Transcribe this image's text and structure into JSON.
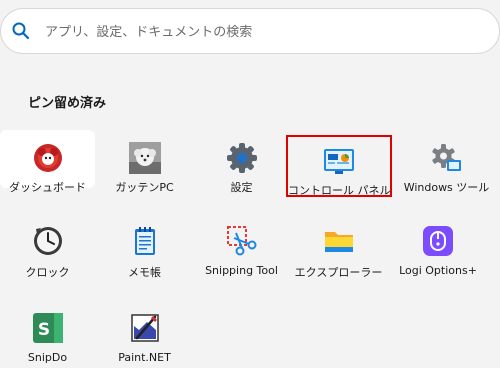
{
  "search": {
    "placeholder": "アプリ、設定、ドキュメントの検索"
  },
  "pinned": {
    "title": "ピン留め済み",
    "items": [
      {
        "label": "ダッシュボード",
        "icon": "dashboard-app-icon"
      },
      {
        "label": "ガッテンPC",
        "icon": "gattenpc-app-icon"
      },
      {
        "label": "設定",
        "icon": "settings-gear-icon"
      },
      {
        "label": "コントロール パネル",
        "icon": "control-panel-icon"
      },
      {
        "label": "Windows ツール",
        "icon": "windows-tools-icon"
      },
      {
        "label": "クロック",
        "icon": "clock-icon"
      },
      {
        "label": "メモ帳",
        "icon": "notepad-icon"
      },
      {
        "label": "Snipping Tool",
        "icon": "snipping-tool-icon"
      },
      {
        "label": "エクスプローラー",
        "icon": "folder-icon"
      },
      {
        "label": "Logi Options+",
        "icon": "logi-options-icon"
      },
      {
        "label": "SnipDo",
        "icon": "snipdo-icon"
      },
      {
        "label": "Paint.NET",
        "icon": "paint-net-icon"
      }
    ]
  },
  "colors": {
    "selection_border": "#e00000",
    "accent": "#0067c0"
  }
}
